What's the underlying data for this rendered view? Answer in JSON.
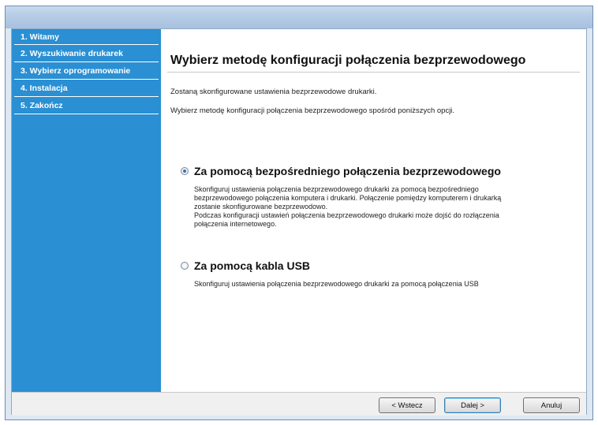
{
  "sidebar": {
    "steps": [
      {
        "label": "1. Witamy"
      },
      {
        "label": "2. Wyszukiwanie drukarek"
      },
      {
        "label": "3. Wybierz oprogramowanie"
      },
      {
        "label": "4. Instalacja"
      },
      {
        "label": "5. Zakończ"
      }
    ]
  },
  "main": {
    "title": "Wybierz metodę konfiguracji połączenia bezprzewodowego",
    "intro1": "Zostaną skonfigurowane ustawienia bezprzewodowe drukarki.",
    "intro2": "Wybierz metodę konfiguracji połączenia bezprzewodowego spośród poniższych opcji.",
    "options": [
      {
        "selected": true,
        "title": "Za pomocą bezpośredniego połączenia bezprzewodowego",
        "desc": [
          "Skonfiguruj ustawienia połączenia bezprzewodowego drukarki za pomocą bezpośredniego",
          "bezprzewodowego połączenia komputera i drukarki. Połączenie pomiędzy komputerem i drukarką",
          "zostanie skonfigurowane bezprzewodowo.",
          "Podczas konfiguracji ustawień połączenia bezprzewodowego drukarki może dojść do rozłączenia",
          "połączenia internetowego."
        ]
      },
      {
        "selected": false,
        "title": "Za pomocą kabla USB",
        "desc": [
          "Skonfiguruj ustawienia połączenia bezprzewodowego drukarki za pomocą połączenia USB"
        ]
      }
    ]
  },
  "footer": {
    "back_label": "< Wstecz",
    "next_label": "Dalej >",
    "cancel_label": "Anuluj"
  }
}
